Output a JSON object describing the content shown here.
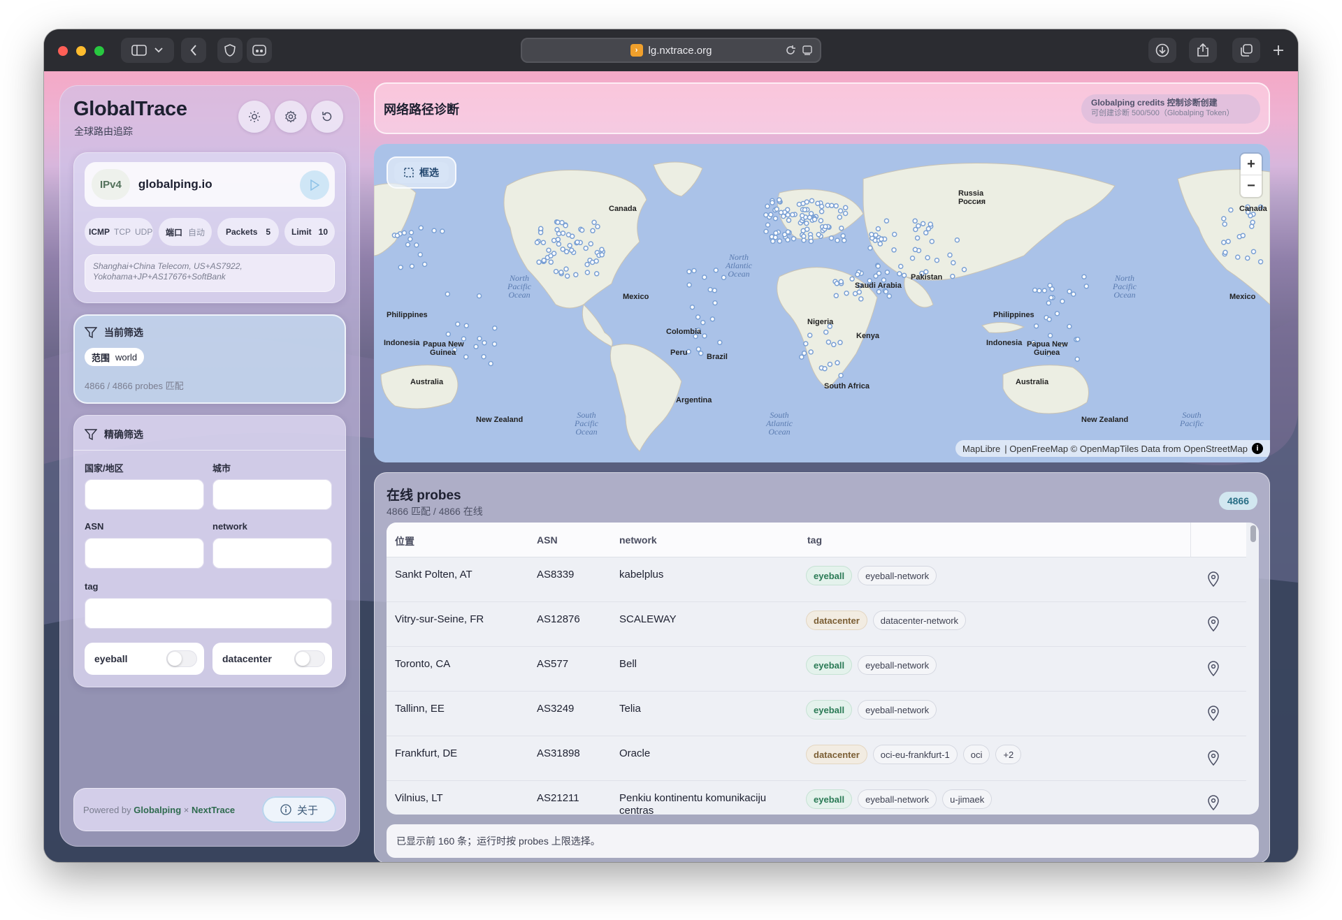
{
  "browser": {
    "url": "lg.nxtrace.org",
    "favicon_glyph": "›"
  },
  "sidebar": {
    "logo": "GlobalTrace",
    "subtitle": "全球路由追踪",
    "target": {
      "protocol_badge": "IPv4",
      "value": "globalping.io"
    },
    "options": {
      "proto_icmp": "ICMP",
      "proto_tcp": "TCP",
      "proto_udp": "UDP",
      "port_label": "端口",
      "port_value": "自动",
      "packets_label": "Packets",
      "packets_value": "5",
      "limit_label": "Limit",
      "limit_value": "10"
    },
    "location_text": "Shanghai+China Telecom, US+AS7922, Yokohama+JP+AS17676+SoftBank",
    "current_filter": {
      "title": "当前筛选",
      "scope_key": "范围",
      "scope_value": "world",
      "match_text": "4866 / 4866 probes 匹配"
    },
    "precise_filter": {
      "title": "精确筛选",
      "country_label": "国家/地区",
      "city_label": "城市",
      "asn_label": "ASN",
      "network_label": "network",
      "tag_label": "tag",
      "toggle_eyeball": "eyeball",
      "toggle_datacenter": "datacenter"
    },
    "footer": {
      "powered_by": "Powered by",
      "globalping": "Globalping",
      "times": "×",
      "nexttrace": "NextTrace",
      "about": "关于"
    }
  },
  "header": {
    "title": "网络路径诊断",
    "credits_title": "Globalping credits 控制诊断创建",
    "credits_sub": "可创建诊断 500/500（Globalping Token）"
  },
  "map": {
    "box_select": "框选",
    "zoom_in": "+",
    "zoom_out": "−",
    "attribution_maplibre": "MapLibre",
    "attribution_rest": "| OpenFreeMap © OpenMapTiles Data from OpenStreetMap",
    "labels": {
      "canada": "Canada",
      "canada_right": "Canada",
      "russia": "Russia",
      "russia_ru": "Россия",
      "mexico": "Mexico",
      "mexico_right": "Mexico",
      "colombia": "Colombia",
      "peru": "Peru",
      "brazil": "Brazil",
      "nigeria": "Nigeria",
      "kenya": "Kenya",
      "south_africa": "South Africa",
      "saudi": "Saudi Arabia",
      "pakistan": "Pakistan",
      "philippines": "Philippines",
      "philippines_right": "Philippines",
      "indonesia": "Indonesia",
      "indonesia_right": "Indonesia",
      "png": "Papua New",
      "png2": "Guinea",
      "png_right": "Papua New",
      "png2_right": "Guinea",
      "australia": "Australia",
      "australia_right": "Australia",
      "nz": "New Zealand",
      "nz_right": "New Zealand",
      "north_pacific_l1": "North",
      "north_pacific_l2": "Pacific",
      "north_pacific_l3": "Ocean",
      "north_atlantic_l1": "North",
      "north_atlantic_l2": "Atlantic",
      "north_atlantic_l3": "Ocean",
      "south_pacific_l1": "South",
      "south_pacific_l2": "Pacific",
      "south_pacific_l3": "Ocean",
      "south_atlantic_l1": "South",
      "south_atlantic_l2": "Atlantic",
      "south_atlantic_l3": "Ocean",
      "north_pacific_r1": "North",
      "north_pacific_r2": "Pacific",
      "north_pacific_r3": "Ocean",
      "south_pacific_r1": "South",
      "south_pacific_r2": "Pacific",
      "argentina": "Argentina"
    }
  },
  "probes": {
    "title": "在线 probes",
    "subtitle": "4866 匹配 / 4866 在线",
    "count_badge": "4866",
    "columns": {
      "location": "位置",
      "asn": "ASN",
      "network": "network",
      "tag": "tag"
    },
    "rows": [
      {
        "location": "Sankt Polten, AT",
        "asn": "AS8339",
        "network": "kabelplus",
        "tags": [
          "eyeball",
          "eyeball-network"
        ]
      },
      {
        "location": "Vitry-sur-Seine, FR",
        "asn": "AS12876",
        "network": "SCALEWAY",
        "tags": [
          "datacenter",
          "datacenter-network"
        ]
      },
      {
        "location": "Toronto, CA",
        "asn": "AS577",
        "network": "Bell",
        "tags": [
          "eyeball",
          "eyeball-network"
        ]
      },
      {
        "location": "Tallinn, EE",
        "asn": "AS3249",
        "network": "Telia",
        "tags": [
          "eyeball",
          "eyeball-network"
        ]
      },
      {
        "location": "Frankfurt, DE",
        "asn": "AS31898",
        "network": "Oracle",
        "tags": [
          "datacenter",
          "oci-eu-frankfurt-1",
          "oci",
          "+2"
        ]
      },
      {
        "location": "Vilnius, LT",
        "asn": "AS21211",
        "network": "Penkiu kontinentu komunikaciju centras",
        "tags": [
          "eyeball",
          "eyeball-network",
          "u-jimaek"
        ]
      }
    ],
    "note": "已显示前 160 条；运行时按 probes 上限选择。"
  }
}
